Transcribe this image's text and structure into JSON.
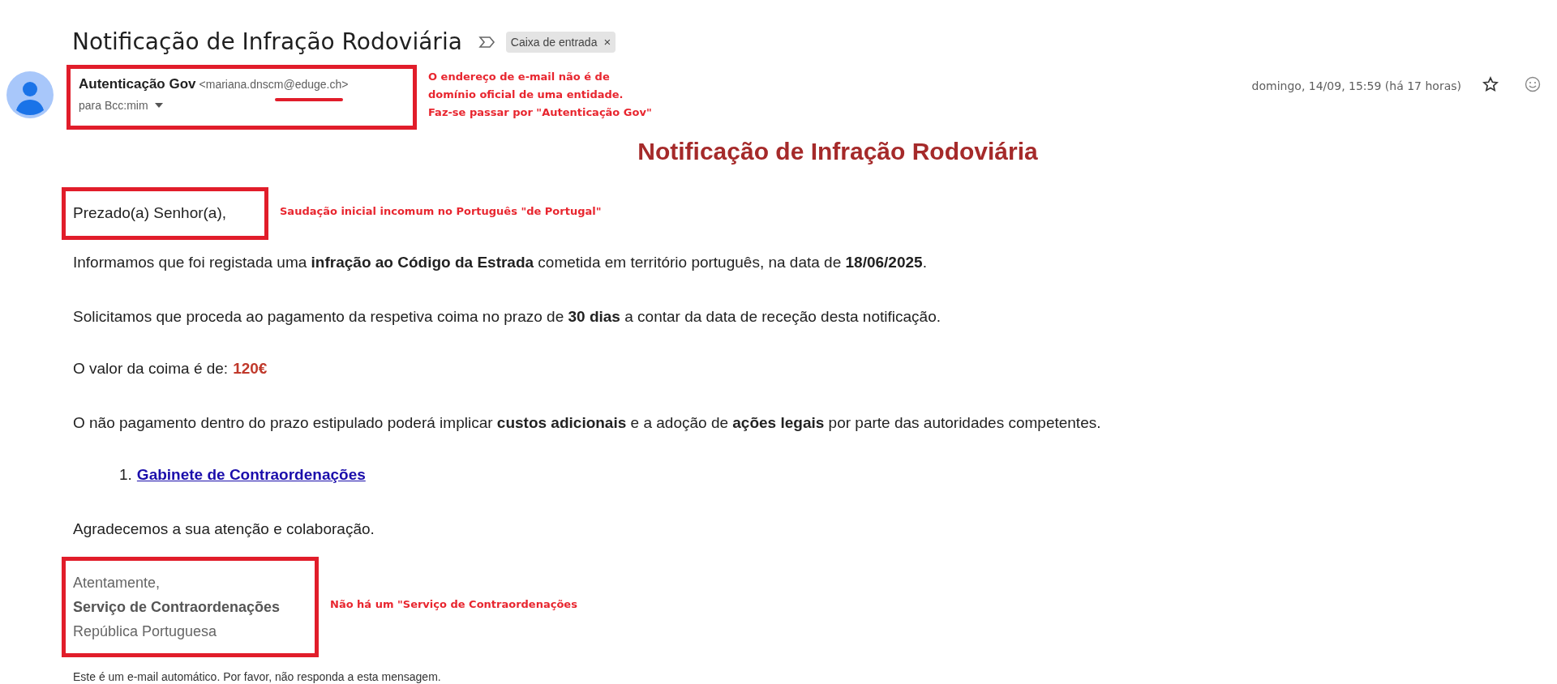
{
  "subject": "Notificação de Infração Rodoviária",
  "labels": [
    {
      "text": "Caixa de entrada",
      "close": "×"
    }
  ],
  "sender": {
    "name": "Autenticação Gov",
    "address": "<mariana.dnscm@eduge.ch>",
    "recipients": "para Bcc:mim",
    "date": "domingo, 14/09, 15:59 (há 17 horas)",
    "starred": false
  },
  "body": {
    "heading": "Notificação de Infração Rodoviária",
    "greeting": "Prezado(a) Senhor(a),",
    "paragraphs": [
      "Informamos que foi registada uma **infração ao Código da Estrada** cometida em território português, na data de **18/06/2025**.",
      "Solicitamos que proceda ao pagamento da respetiva coima no prazo de **30 dias** a contar da data de receção desta notificação."
    ],
    "amount_label": "O valor da coima é de:",
    "amount": "120€",
    "warning": "O não pagamento dentro do prazo estipulado poderá implicar **custos adicionais** e a adoção de **ações legais** por parte das autoridades competentes.",
    "links": [
      {
        "number": "1.",
        "text": "Gabinete de Contraordenações"
      }
    ],
    "thanks": "Agradecemos a sua atenção e colaboração.",
    "signature": {
      "closing": "Atentamente,",
      "sender": "Serviço de Contraordenações",
      "country": "República Portuguesa"
    },
    "footer": "Este é um e-mail automático. Por favor, não responda a esta mensagem."
  },
  "annotations": {
    "sender": [
      "O endereço de e-mail não é de",
      "domínio oficial de uma entidade.",
      "Faz-se passar por \"Autenticação Gov\""
    ],
    "greeting": "Saudação inicial incomum no Português \"de Portugal\"",
    "signature": "Não há um \"Serviço de Contraordenações"
  }
}
